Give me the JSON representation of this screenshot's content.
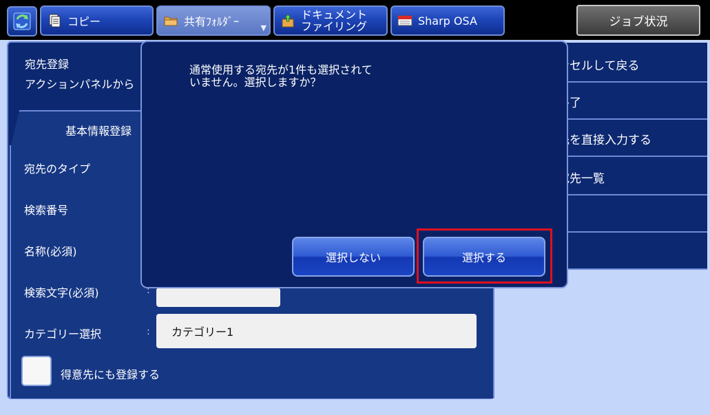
{
  "topbar": {
    "home_icon": "refresh-arrows-icon",
    "tabs": [
      {
        "label": "コピー",
        "icon": "copy-document-icon"
      },
      {
        "label": "共有ﾌｫﾙﾀﾞｰ",
        "icon": "folder-icon",
        "active": true
      },
      {
        "line1": "ドキュメント",
        "line2": "ファイリング",
        "icon": "document-filing-icon"
      },
      {
        "label": "Sharp OSA",
        "icon": "osa-icon"
      }
    ],
    "job_status": "ジョブ状況"
  },
  "panel": {
    "title": "宛先登録",
    "subtitle": "アクションパネルから",
    "tab_basic": "基本情報登録"
  },
  "form": {
    "type_label": "宛先のタイプ",
    "search_no_label": "検索番号",
    "name_label": "名称(必須)",
    "search_char_label": "検索文字(必須)",
    "category_label": "カテゴリー選択",
    "category_value": "カテゴリー1",
    "favorite_label": "得意先にも登録する"
  },
  "actions": [
    "ンセルして戻る",
    "終了",
    "先を直接入力する",
    "宛先一覧"
  ],
  "dialog": {
    "message": "通常使用する宛先が1件も選択されて\nいません。選択しますか？",
    "btn_no": "選択しない",
    "btn_yes": "選択する"
  },
  "colors": {
    "highlight": "#e0101e",
    "panel": "#0c2870",
    "background": "#c5d6fb"
  }
}
